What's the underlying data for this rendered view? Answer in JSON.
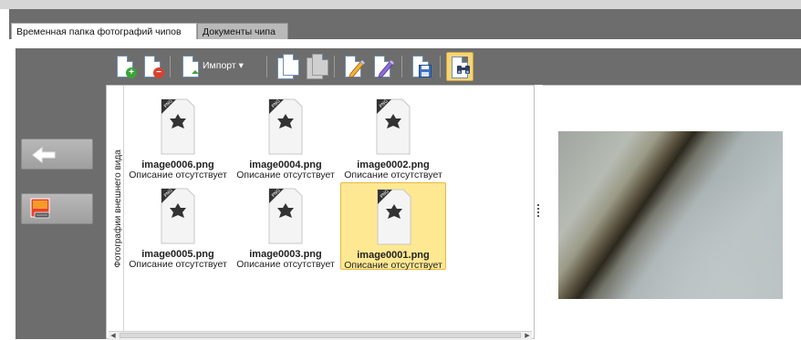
{
  "tabs": [
    {
      "label": "Временная папка фотографий чипов",
      "active": true
    },
    {
      "label": "Документы чипа",
      "active": false
    }
  ],
  "toolbar": {
    "import_label": "Импорт"
  },
  "left_panel": {
    "buttons": [
      {
        "name": "back",
        "icon": "arrow-left-icon"
      },
      {
        "name": "photo",
        "icon": "chip-photo-icon"
      }
    ]
  },
  "gallery": {
    "side_label": "Фотографии внешнего вида",
    "items": [
      {
        "name": "image0006.png",
        "description": "Описание отсутствует",
        "selected": false
      },
      {
        "name": "image0004.png",
        "description": "Описание отсутствует",
        "selected": false
      },
      {
        "name": "image0002.png",
        "description": "Описание отсутствует",
        "selected": false
      },
      {
        "name": "image0005.png",
        "description": "Описание отсутствует",
        "selected": false
      },
      {
        "name": "image0003.png",
        "description": "Описание отсутствует",
        "selected": false
      },
      {
        "name": "image0001.png",
        "description": "Описание отсутствует",
        "selected": true
      }
    ],
    "file_badge": "PNG"
  },
  "colors": {
    "chrome": "#6d6d6d",
    "selection": "#ffe892",
    "selection_border": "#e6b84c"
  }
}
